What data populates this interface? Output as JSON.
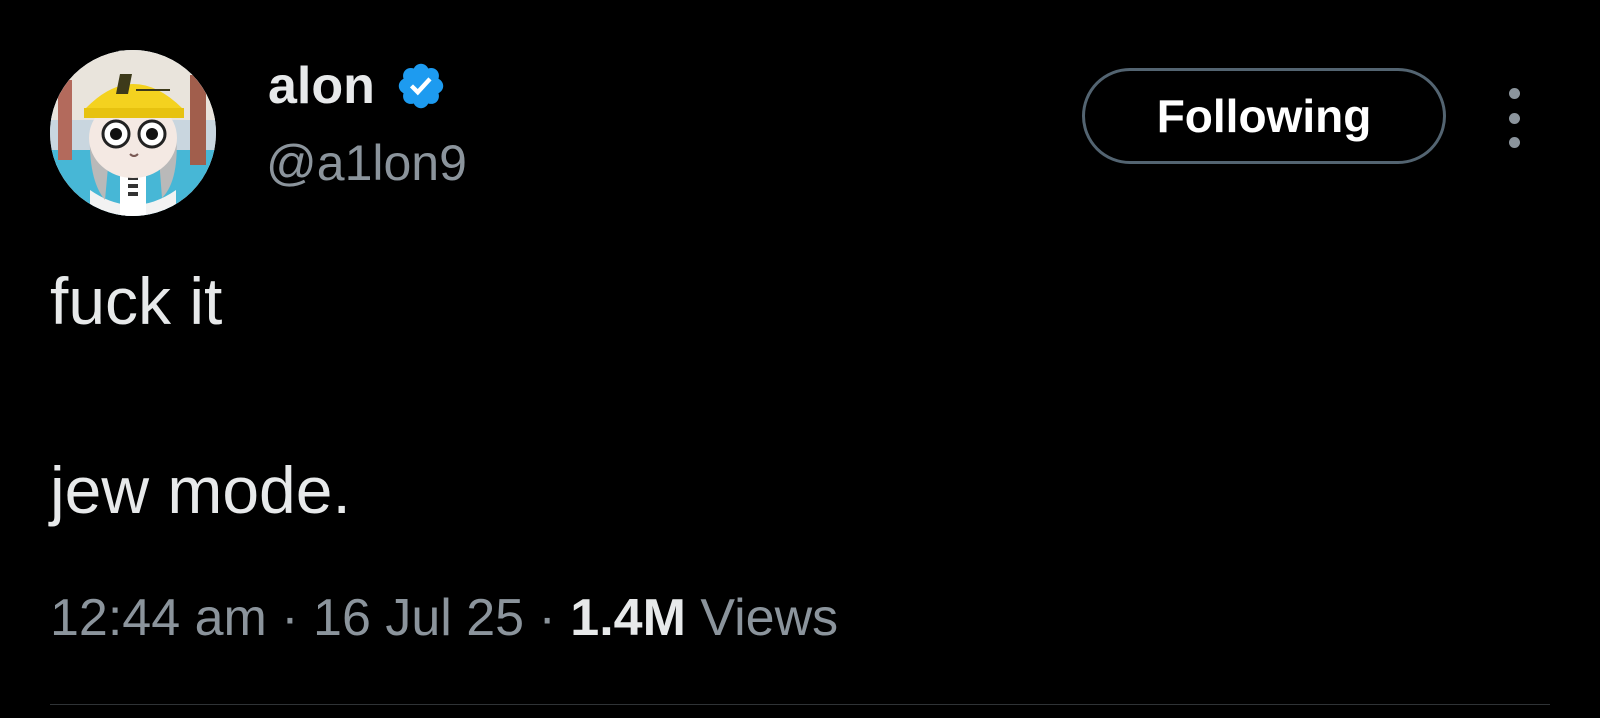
{
  "author": {
    "display_name": "alon",
    "handle": "@a1lon9",
    "verified": true,
    "verified_color": "#1d9bf0",
    "avatar_icon": "cartoon-avatar-yellow-cap"
  },
  "follow_button": {
    "label": "Following"
  },
  "more_menu": {
    "icon": "more-vertical-icon"
  },
  "tweet": {
    "lines": [
      "fuck it",
      "jew mode."
    ]
  },
  "meta": {
    "time": "12:44 am",
    "separator": " · ",
    "date": "16 Jul 25",
    "views_count": "1.4M",
    "views_label": "Views"
  },
  "colors": {
    "background": "#000000",
    "text_primary": "#e7e9ea",
    "text_secondary": "#8b949c",
    "border": "#536471"
  }
}
